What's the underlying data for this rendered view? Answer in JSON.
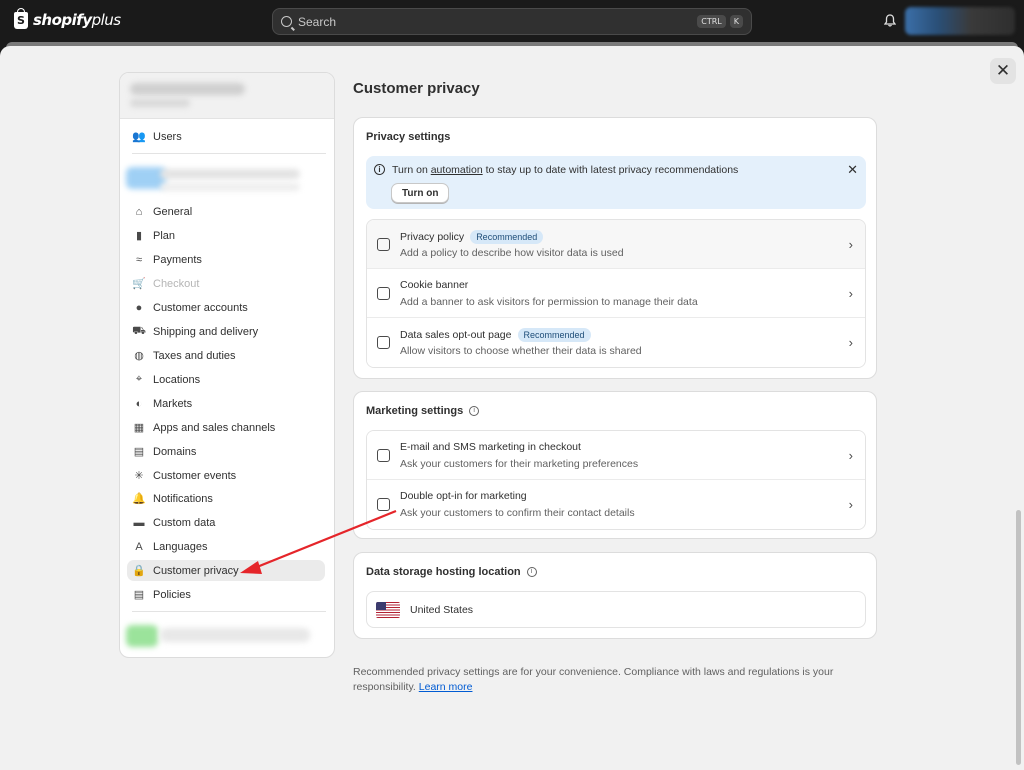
{
  "topbar": {
    "logo": "shopify",
    "logo_plus": "plus",
    "search_placeholder": "Search",
    "shortcut_ctrl": "CTRL",
    "shortcut_key": "K"
  },
  "sidebar": {
    "items": [
      {
        "label": "Users",
        "icon": "users-icon"
      },
      {
        "label": "General",
        "icon": "store-icon"
      },
      {
        "label": "Plan",
        "icon": "plan-icon"
      },
      {
        "label": "Payments",
        "icon": "payments-icon"
      },
      {
        "label": "Checkout",
        "icon": "cart-icon",
        "disabled": true
      },
      {
        "label": "Customer accounts",
        "icon": "person-icon"
      },
      {
        "label": "Shipping and delivery",
        "icon": "truck-icon"
      },
      {
        "label": "Taxes and duties",
        "icon": "tax-icon"
      },
      {
        "label": "Locations",
        "icon": "location-icon"
      },
      {
        "label": "Markets",
        "icon": "globe-icon"
      },
      {
        "label": "Apps and sales channels",
        "icon": "apps-icon"
      },
      {
        "label": "Domains",
        "icon": "domain-icon"
      },
      {
        "label": "Customer events",
        "icon": "events-icon"
      },
      {
        "label": "Notifications",
        "icon": "bell-icon"
      },
      {
        "label": "Custom data",
        "icon": "data-icon"
      },
      {
        "label": "Languages",
        "icon": "language-icon"
      },
      {
        "label": "Customer privacy",
        "icon": "lock-icon",
        "active": true
      },
      {
        "label": "Policies",
        "icon": "policy-icon"
      }
    ]
  },
  "main": {
    "title": "Customer privacy",
    "privacy": {
      "title": "Privacy settings",
      "banner_pre": "Turn on ",
      "banner_link": "automation",
      "banner_post": " to stay up to date with latest privacy recommendations",
      "banner_button": "Turn on",
      "rows": [
        {
          "title": "Privacy policy",
          "badge": "Recommended",
          "subtitle": "Add a policy to describe how visitor data is used"
        },
        {
          "title": "Cookie banner",
          "badge": "",
          "subtitle": "Add a banner to ask visitors for permission to manage their data"
        },
        {
          "title": "Data sales opt-out page",
          "badge": "Recommended",
          "subtitle": "Allow visitors to choose whether their data is shared"
        }
      ]
    },
    "marketing": {
      "title": "Marketing settings",
      "rows": [
        {
          "title": "E-mail and SMS marketing in checkout",
          "subtitle": "Ask your customers for their marketing preferences"
        },
        {
          "title": "Double opt-in for marketing",
          "subtitle": "Ask your customers to confirm their contact details"
        }
      ]
    },
    "storage": {
      "title": "Data storage hosting location",
      "country": "United States"
    },
    "footer_text": "Recommended privacy settings are for your convenience. Compliance with laws and regulations is your responsibility.",
    "footer_link": "Learn more"
  },
  "colors": {
    "accent_link": "#005bd3",
    "banner_bg": "#e4f0fb",
    "badge_bg": "#d6e8f8",
    "annotation_arrow": "#e5252a"
  }
}
